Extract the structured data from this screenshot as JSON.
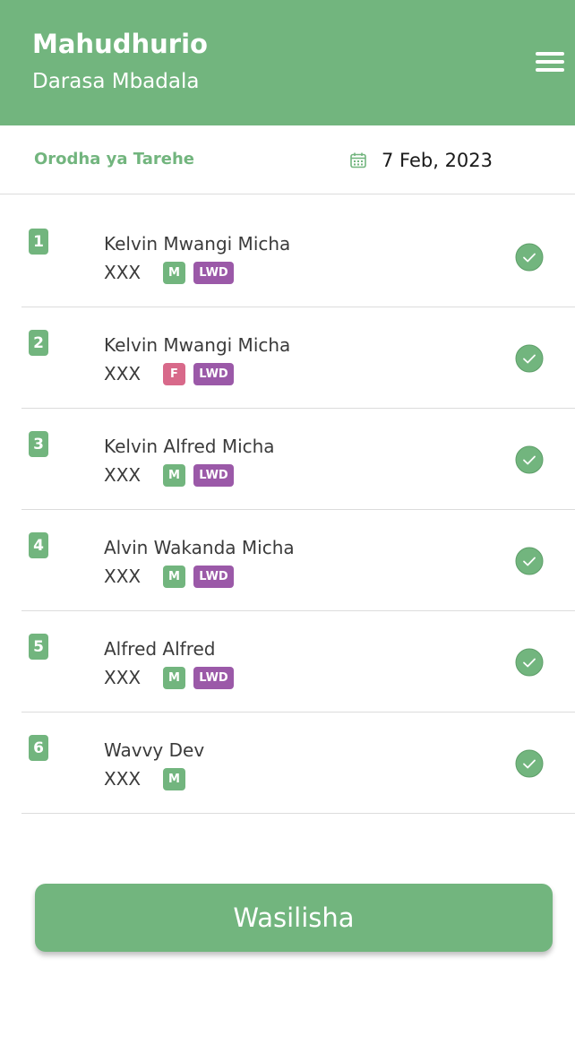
{
  "header": {
    "title": "Mahudhurio",
    "subtitle": "Darasa Mbadala"
  },
  "date_bar": {
    "label": "Orodha ya Tarehe",
    "date": "7 Feb, 2023"
  },
  "colors": {
    "primary": "#72b57e",
    "male_badge": "#72b57e",
    "female_badge": "#d8698a",
    "lwd_badge": "#9b59a8"
  },
  "students": [
    {
      "number": "1",
      "name": "Kelvin Mwangi Micha",
      "code": "XXX",
      "gender": "M",
      "lwd": "LWD",
      "present": true
    },
    {
      "number": "2",
      "name": "Kelvin Mwangi Micha",
      "code": "XXX",
      "gender": "F",
      "lwd": "LWD",
      "present": true
    },
    {
      "number": "3",
      "name": "Kelvin Alfred Micha",
      "code": "XXX",
      "gender": "M",
      "lwd": "LWD",
      "present": true
    },
    {
      "number": "4",
      "name": "Alvin Wakanda Micha",
      "code": "XXX",
      "gender": "M",
      "lwd": "LWD",
      "present": true
    },
    {
      "number": "5",
      "name": "Alfred Alfred",
      "code": "XXX",
      "gender": "M",
      "lwd": "LWD",
      "present": true
    },
    {
      "number": "6",
      "name": "Wavvy Dev",
      "code": "XXX",
      "gender": "M",
      "lwd": null,
      "present": true
    }
  ],
  "submit_label": "Wasilisha"
}
